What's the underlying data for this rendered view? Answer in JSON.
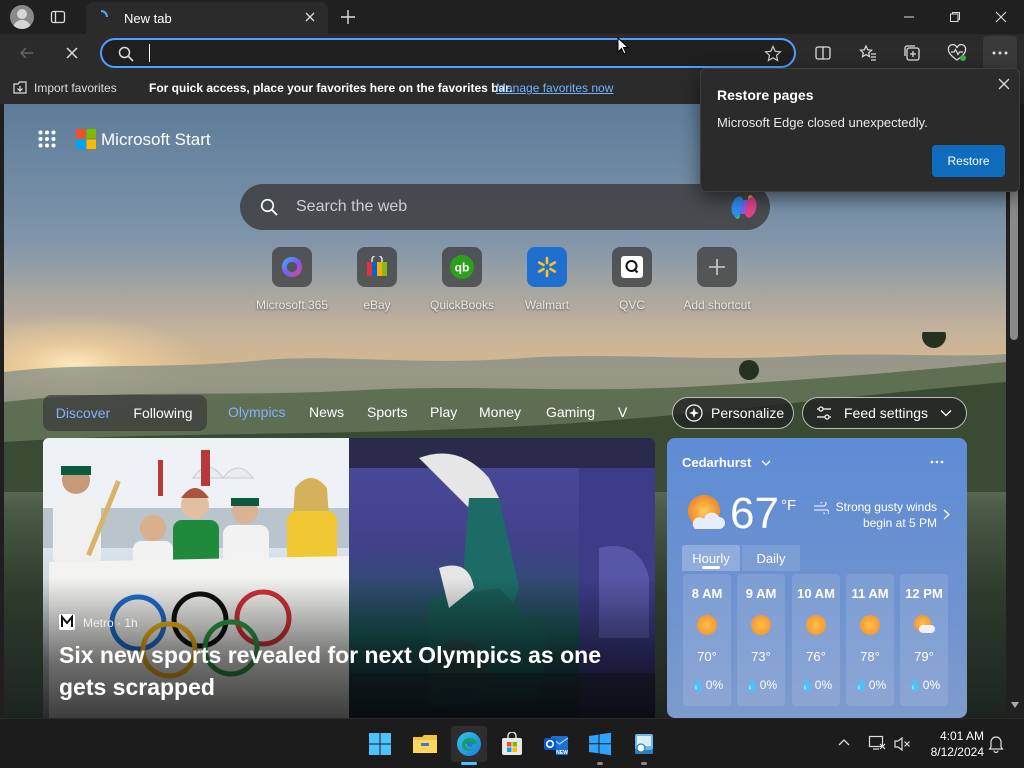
{
  "browser": {
    "tab_title": "New tab",
    "address_value": "",
    "favorites_bar": {
      "import_label": "Import favorites",
      "hint": "For quick access, place your favorites here on the favorites bar.",
      "manage_link": "Manage favorites now"
    }
  },
  "restore_popup": {
    "title": "Restore pages",
    "message": "Microsoft Edge closed unexpectedly.",
    "button": "Restore"
  },
  "start": {
    "brand": "Microsoft Start",
    "search_placeholder": "Search the web",
    "shortcuts": [
      {
        "label": "Microsoft 365",
        "icon": "microsoft-365-icon"
      },
      {
        "label": "eBay",
        "icon": "ebay-icon"
      },
      {
        "label": "QuickBooks",
        "icon": "quickbooks-icon"
      },
      {
        "label": "Walmart",
        "icon": "walmart-icon"
      },
      {
        "label": "QVC",
        "icon": "qvc-icon"
      },
      {
        "label": "Add shortcut",
        "icon": "plus-icon"
      }
    ],
    "feed_toggle": {
      "discover": "Discover",
      "following": "Following"
    },
    "nav": [
      "Olympics",
      "News",
      "Sports",
      "Play",
      "Money",
      "Gaming",
      "V"
    ],
    "personalize": "Personalize",
    "feed_settings": "Feed settings"
  },
  "news": {
    "source": "Metro · 1h",
    "headline": "Six new sports revealed for next Olympics as one gets scrapped"
  },
  "weather": {
    "location": "Cedarhurst",
    "temperature": "67",
    "unit": "°F",
    "alert": "Strong gusty winds begin at 5 PM",
    "tabs": [
      "Hourly",
      "Daily"
    ],
    "hourly": [
      {
        "time": "8 AM",
        "temp": "70°",
        "precip": "0%",
        "icon": "sun-icon"
      },
      {
        "time": "9 AM",
        "temp": "73°",
        "precip": "0%",
        "icon": "sun-icon"
      },
      {
        "time": "10 AM",
        "temp": "76°",
        "precip": "0%",
        "icon": "sun-icon"
      },
      {
        "time": "11 AM",
        "temp": "78°",
        "precip": "0%",
        "icon": "sun-icon"
      },
      {
        "time": "12 PM",
        "temp": "79°",
        "precip": "0%",
        "icon": "partly-cloudy-icon"
      }
    ]
  },
  "taskbar": {
    "time": "4:01 AM",
    "date": "8/12/2024"
  },
  "colors": {
    "accent": "#0f6cbd",
    "link": "#4ea1ff",
    "weather_card": "#6a8fd3"
  }
}
